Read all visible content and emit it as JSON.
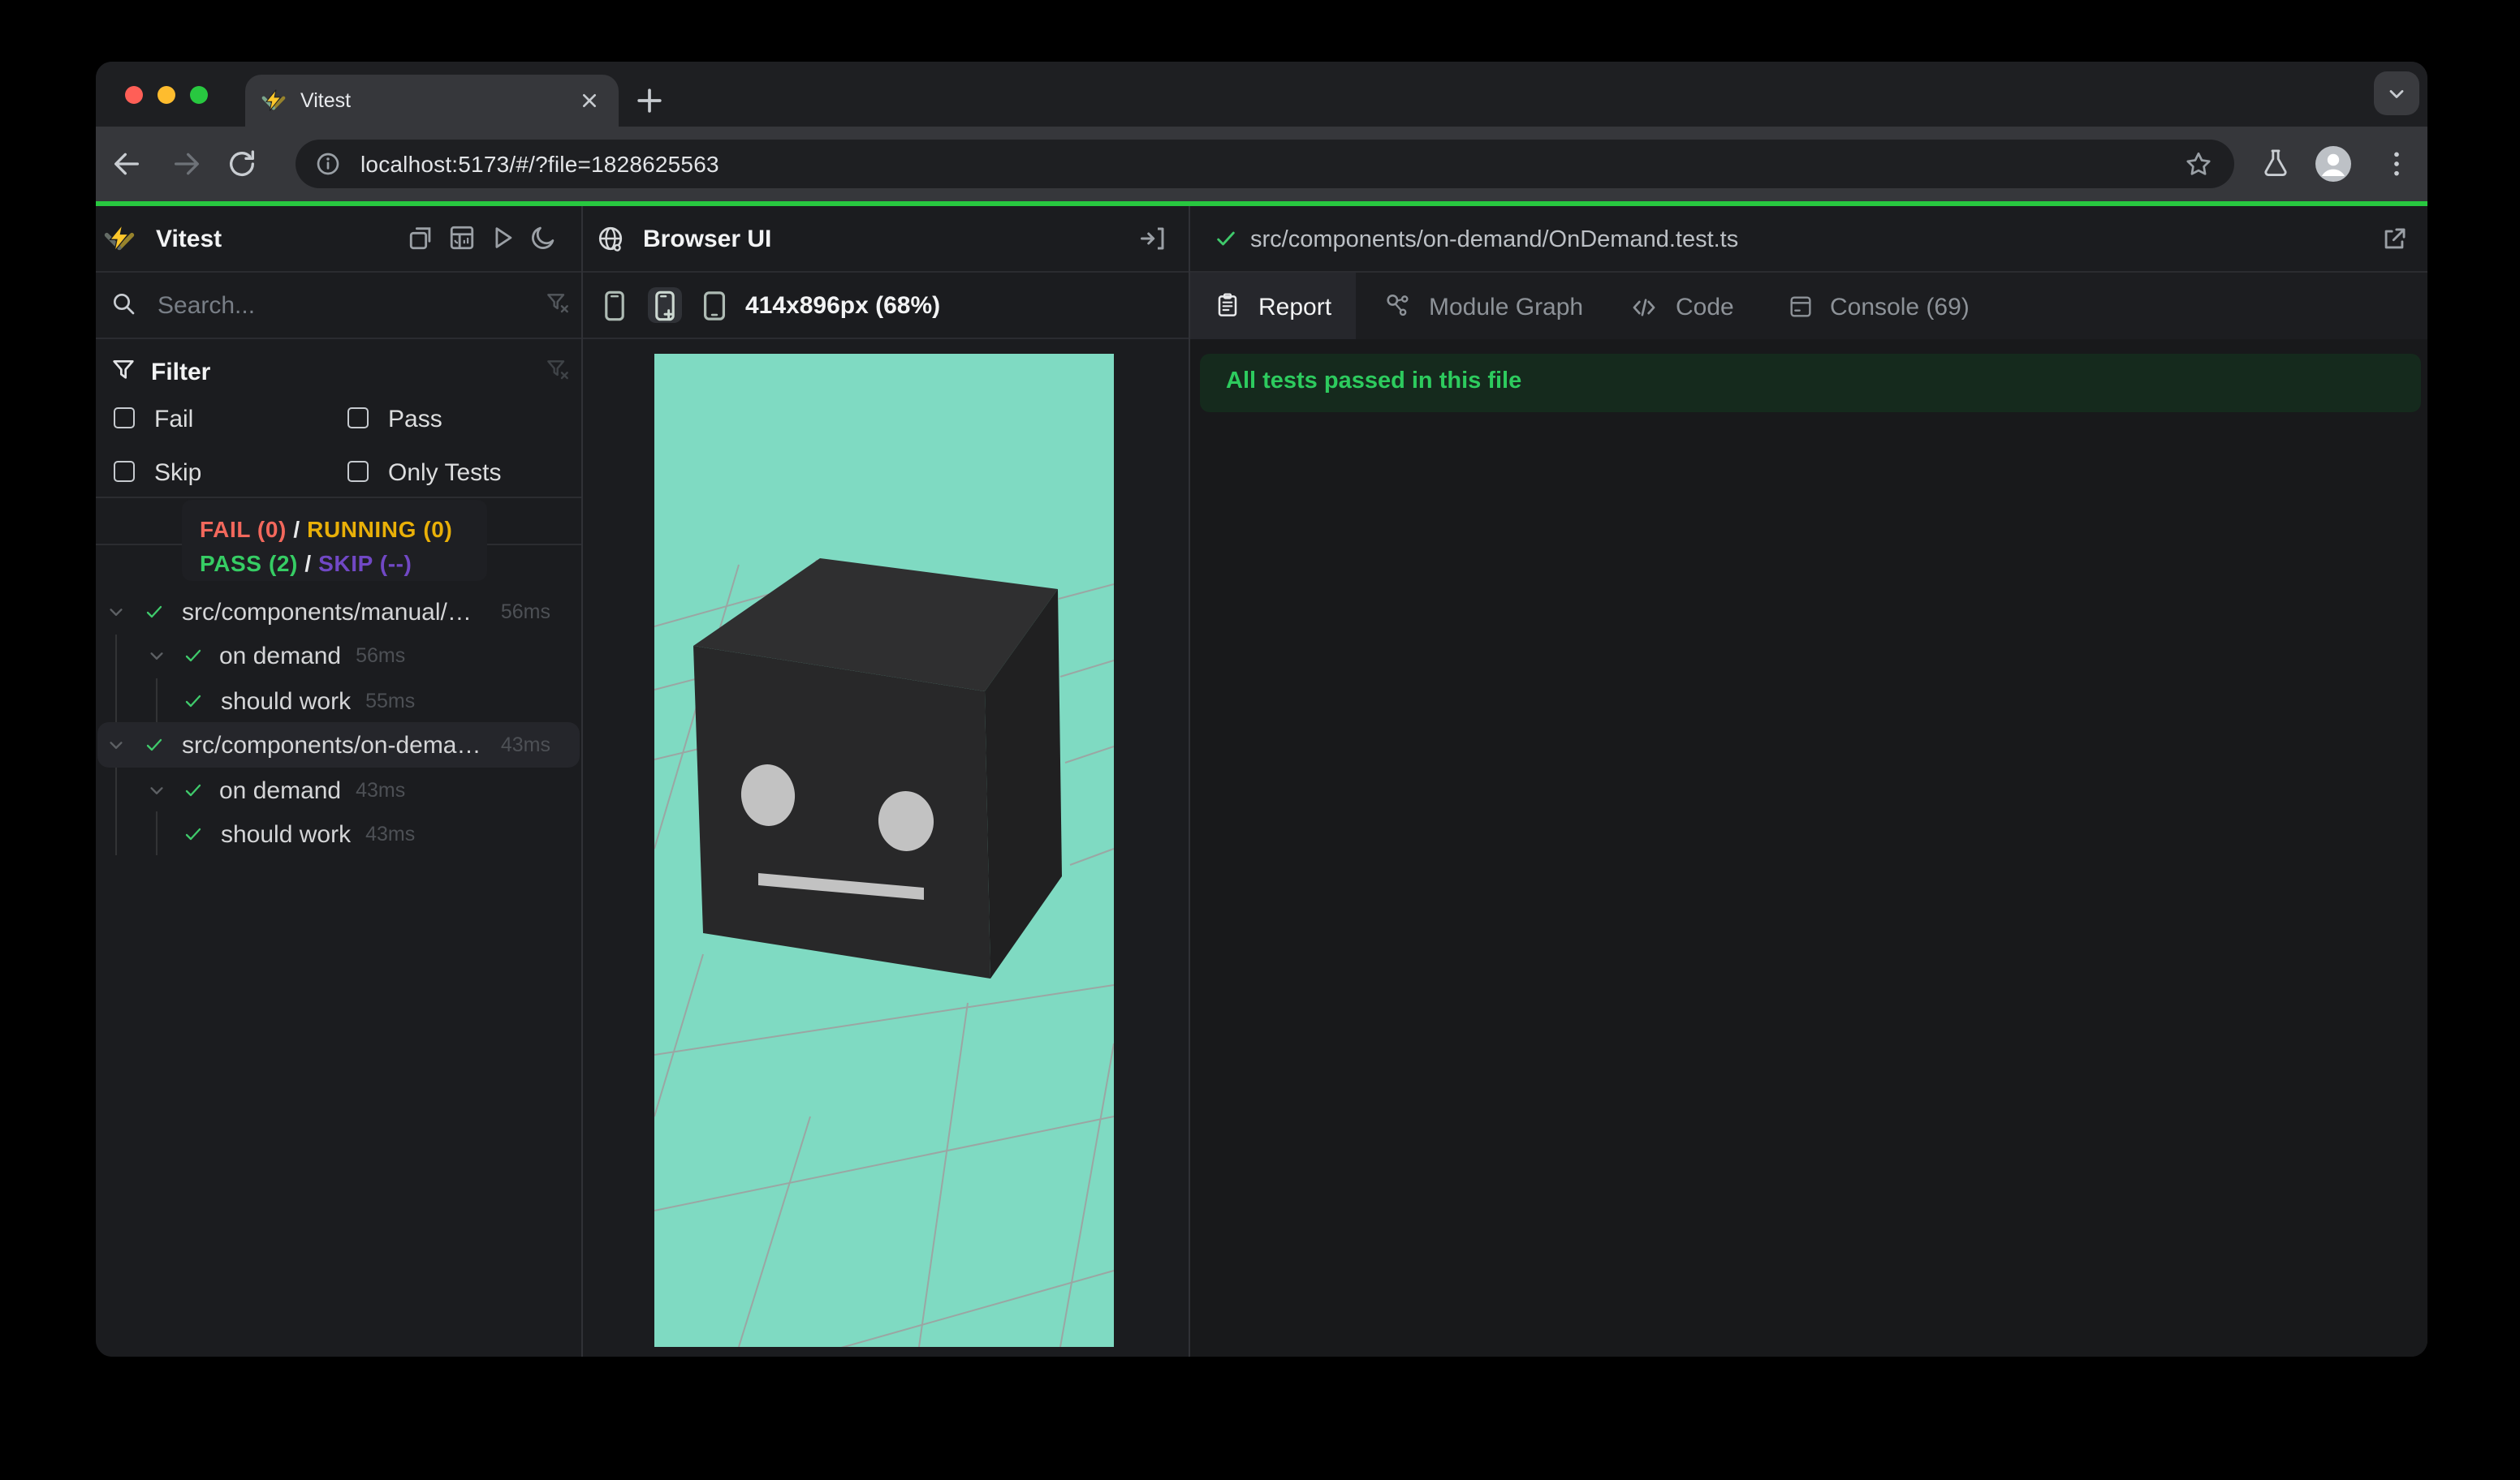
{
  "browser": {
    "tab_title": "Vitest",
    "url": "localhost:5173/#/?file=1828625563",
    "traffic_lights": [
      "#ff5f57",
      "#febc2e",
      "#28c840"
    ],
    "progress_color": "#28c840"
  },
  "sidebar": {
    "app_title": "Vitest",
    "search_placeholder": "Search...",
    "filter_title": "Filter",
    "filters": {
      "fail": "Fail",
      "pass": "Pass",
      "skip": "Skip",
      "only": "Only Tests"
    },
    "stats": {
      "fail": "FAIL (0)",
      "running": "RUNNING (0)",
      "pass": "PASS (2)",
      "skip": "SKIP (--)",
      "sep": " / ",
      "colors": {
        "fail": "#f2685c",
        "running": "#e9b008",
        "pass": "#36cd64",
        "skip": "#7148c5"
      }
    },
    "tree": [
      {
        "label": "src/components/manual/…",
        "time": "56ms"
      },
      {
        "label": "on demand",
        "time": "56ms"
      },
      {
        "label": "should work",
        "time": "55ms"
      },
      {
        "label": "src/components/on-dema…",
        "time": "43ms"
      },
      {
        "label": "on demand",
        "time": "43ms"
      },
      {
        "label": "should work",
        "time": "43ms"
      }
    ]
  },
  "preview": {
    "title": "Browser UI",
    "viewport_label": "414x896px (68%)",
    "canvas_bg": "#7fdac2"
  },
  "results": {
    "file_path": "src/components/on-demand/OnDemand.test.ts",
    "tabs": {
      "report": "Report",
      "module_graph": "Module Graph",
      "code": "Code",
      "console": "Console (69)"
    },
    "banner": "All tests passed in this file",
    "banner_color": "#2dcb5e"
  }
}
